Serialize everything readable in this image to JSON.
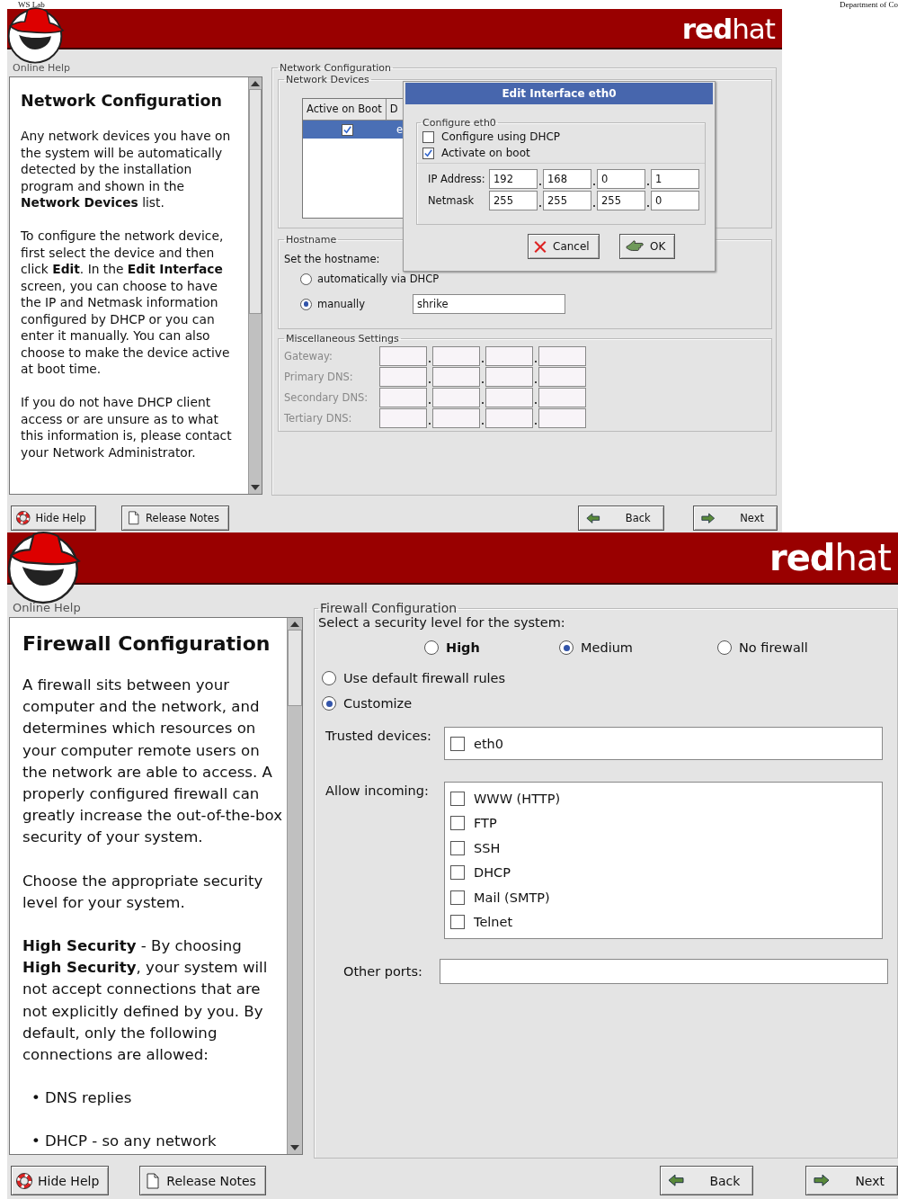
{
  "document_header": {
    "left": "WS Lab",
    "right": "Department of Co"
  },
  "network_screen": {
    "brand": "**red**hat",
    "help": {
      "label": "Online Help",
      "title": "Network Configuration",
      "blocks": [
        {
          "kind": "paragraph",
          "text": "Any network devices you have on the system will be automatically detected by the installation program and shown in the **Network Devices** list."
        },
        {
          "kind": "paragraph",
          "text": "To configure the network device, first select the device and then click **Edit**. In the **Edit Interface** screen, you can choose to have the IP and Netmask information configured by DHCP or you can enter it manually. You can also choose to make the device active at boot time."
        },
        {
          "kind": "paragraph",
          "text": "If you do not have DHCP client access or are unsure as to what this information is, please contact your Network Administrator."
        }
      ]
    },
    "config": {
      "legend": "Network Configuration",
      "devices": {
        "legend": "Network Devices",
        "columns": [
          "Active on Boot",
          "D"
        ],
        "rows": [
          {
            "active_on_boot": true,
            "column_2": "e",
            "selected": true
          }
        ]
      },
      "hostname": {
        "legend": "Hostname",
        "prompt": "Set the hostname:",
        "options": [
          {
            "label": "automatically via DHCP",
            "selected": false
          },
          {
            "label": "manually",
            "selected": true
          }
        ],
        "value": "shrike"
      },
      "misc": {
        "legend": "Miscellaneous Settings",
        "rows": [
          {
            "label": "Gateway:",
            "disabled": true
          },
          {
            "label": "Primary DNS:",
            "disabled": true
          },
          {
            "label": "Secondary DNS:",
            "disabled": true
          },
          {
            "label": "Tertiary DNS:",
            "disabled": true
          }
        ]
      }
    },
    "dialog": {
      "title": "Edit Interface eth0",
      "legend": "Configure eth0",
      "options": [
        {
          "label": "Configure using DHCP",
          "checked": false
        },
        {
          "label": "Activate on boot",
          "checked": true
        }
      ],
      "fields": [
        {
          "label": "IP Address:",
          "octets": [
            "192",
            "168",
            "0",
            "1"
          ]
        },
        {
          "label": "Netmask",
          "octets": [
            "255",
            "255",
            "255",
            "0"
          ]
        }
      ],
      "buttons": [
        {
          "label": "Cancel",
          "kind": "cancel"
        },
        {
          "label": "OK",
          "kind": "ok"
        }
      ]
    },
    "buttons": [
      {
        "label": "Hide Help",
        "kind": "help"
      },
      {
        "label": "Release Notes",
        "kind": "notes"
      },
      {
        "label": "Back",
        "kind": "back"
      },
      {
        "label": "Next",
        "kind": "next"
      }
    ]
  },
  "firewall_screen": {
    "brand": "**red**hat",
    "help": {
      "label": "Online Help",
      "title": "Firewall Configuration",
      "blocks": [
        {
          "kind": "paragraph",
          "text": "A firewall sits between your computer and the network, and determines which resources on your computer remote users on the network are able to access. A properly configured firewall can greatly increase the out-of-the-box security of your system."
        },
        {
          "kind": "paragraph",
          "text": "Choose the appropriate security level for your system."
        },
        {
          "kind": "paragraph",
          "text": "**High Security** - By choosing **High Security**, your system will not accept connections that are not explicitly defined by you. By default, only the following connections are allowed:"
        },
        {
          "kind": "bullet",
          "text": "• DNS replies"
        },
        {
          "kind": "bullet",
          "text": "• DHCP - so any network"
        }
      ]
    },
    "config": {
      "legend": "Firewall Configuration",
      "prompt": "Select a security level for the system:",
      "levels": [
        {
          "label": "High",
          "selected": false
        },
        {
          "label": "Medium",
          "selected": true
        },
        {
          "label": "No firewall",
          "selected": false
        }
      ],
      "modes": [
        {
          "label": "Use default firewall rules",
          "selected": false
        },
        {
          "label": "Customize",
          "selected": true
        }
      ],
      "trusted": {
        "label": "Trusted devices:",
        "items": [
          {
            "label": "eth0",
            "checked": false
          }
        ]
      },
      "incoming": {
        "label": "Allow incoming:",
        "items": [
          {
            "label": "WWW (HTTP)",
            "checked": false
          },
          {
            "label": "FTP",
            "checked": false
          },
          {
            "label": "SSH",
            "checked": false
          },
          {
            "label": "DHCP",
            "checked": false
          },
          {
            "label": "Mail (SMTP)",
            "checked": false
          },
          {
            "label": "Telnet",
            "checked": false
          }
        ]
      },
      "other_ports": {
        "label": "Other ports:"
      }
    },
    "buttons": [
      {
        "label": "Hide Help",
        "kind": "help"
      },
      {
        "label": "Release Notes",
        "kind": "notes"
      },
      {
        "label": "Back",
        "kind": "back"
      },
      {
        "label": "Next",
        "kind": "next"
      }
    ]
  }
}
